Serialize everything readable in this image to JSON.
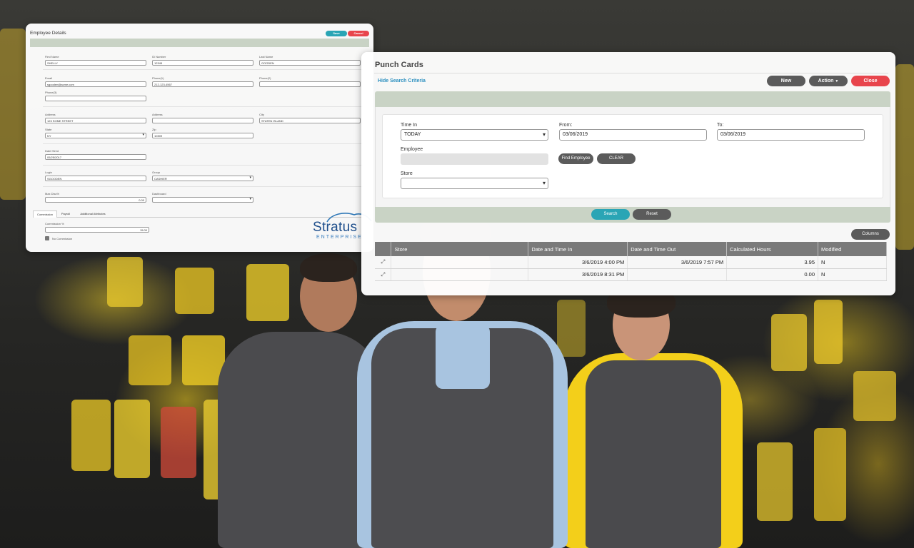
{
  "employee_details": {
    "title": "Employee Details",
    "save_label": "Save",
    "cancel_label": "Cancel",
    "fields": {
      "first_name": {
        "label": "First Name",
        "value": "SHELLY"
      },
      "id_number": {
        "label": "ID Number",
        "value": "12345"
      },
      "last_name": {
        "label": "Last Name",
        "value": "GOODEN"
      },
      "email": {
        "label": "Email",
        "value": "sgooden@acme.com"
      },
      "phone1": {
        "label": "Phone(1)",
        "value": "212-123-4567"
      },
      "phone2": {
        "label": "Phone(2)",
        "value": ""
      },
      "phone3": {
        "label": "Phone(3)",
        "value": ""
      },
      "address1": {
        "label": "Address",
        "value": "123 SOME STREET"
      },
      "address2": {
        "label": "Address",
        "value": ""
      },
      "city": {
        "label": "City",
        "value": "STATEN ISLAND"
      },
      "state": {
        "label": "State",
        "value": "NY"
      },
      "zip": {
        "label": "Zip",
        "value": "10309"
      },
      "date_hired": {
        "label": "Date Hired",
        "value": "05/25/2017"
      },
      "login": {
        "label": "Login",
        "value": "SGOODEN"
      },
      "group": {
        "label": "Group",
        "value": "CASHIER"
      },
      "max_disc": {
        "label": "Max Disc%",
        "value": "0.00"
      },
      "dashboard": {
        "label": "Dashboard",
        "value": ""
      }
    },
    "tabs": [
      "Commission",
      "Payroll",
      "Additional Attributes"
    ],
    "commission_label": "Commission %",
    "commission_value": "15.00",
    "no_commission_label": "No Commission",
    "logo_main": "Stratus",
    "logo_sub": "ENTERPRISE"
  },
  "punch_cards": {
    "title": "Punch Cards",
    "hide_search_label": "Hide Search Criteria",
    "new_label": "New",
    "action_label": "Action",
    "close_label": "Close",
    "time_in_label": "Time In",
    "time_in_value": "TODAY",
    "from_label": "From:",
    "from_value": "03/06/2019",
    "to_label": "To:",
    "to_value": "03/06/2019",
    "employee_label": "Employee",
    "find_employee_label": "Find Employee",
    "clear_label": "CLEAR",
    "store_label": "Store",
    "search_label": "Search",
    "reset_label": "Reset",
    "columns_label": "Columns",
    "table": {
      "headers": [
        "",
        "Store",
        "Date and Time In",
        "Date and Time Out",
        "Calculated Hours",
        "Modified"
      ],
      "rows": [
        {
          "store": "",
          "in": "3/6/2019 4:00 PM",
          "out": "3/6/2019 7:57 PM",
          "hours": "3.95",
          "modified": "N"
        },
        {
          "store": "",
          "in": "3/6/2019 8:31 PM",
          "out": "",
          "hours": "0.00",
          "modified": "N"
        }
      ]
    }
  },
  "colors": {
    "accent_teal": "#2aa5b5",
    "close_red": "#e8454c",
    "button_dark": "#5b5b5b",
    "panel_band": "#c9d3c5"
  }
}
